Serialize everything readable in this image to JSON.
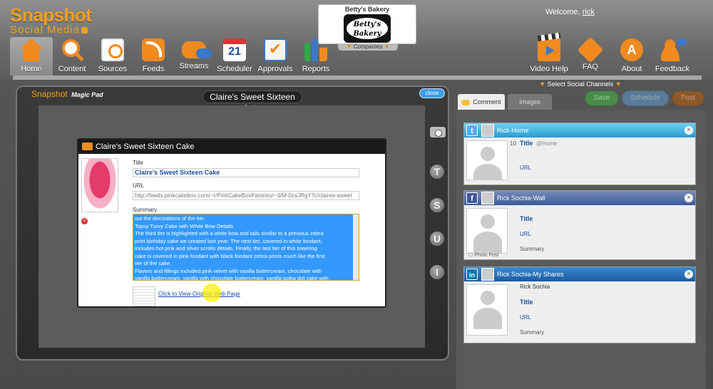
{
  "brand": {
    "line1": "Snapshot",
    "line2": "Social Media"
  },
  "company": {
    "name": "Betty's Bakery",
    "badge_line1": "Betty's",
    "badge_line2": "Bakery",
    "dropdown_label": "Companies"
  },
  "user": {
    "welcome": "Welcome,",
    "name": "rick"
  },
  "nav": {
    "home": "Home",
    "content": "Content",
    "sources": "Sources",
    "feeds": "Feeds",
    "streams": "Streams",
    "scheduler": "Scheduler",
    "scheduler_day": "21",
    "approvals": "Approvals",
    "reports": "Reports",
    "video": "Video Help",
    "faq": "FAQ",
    "about": "About",
    "feedback": "Feedback"
  },
  "pad": {
    "title": "Snapshot",
    "subtitle": "Magic Pad",
    "heading": "Claire's Sweet Sixteen Cake",
    "close": "close",
    "tools": [
      "T",
      "S",
      "U",
      "I"
    ]
  },
  "card": {
    "header": "Claire's Sweet Sixteen Cake",
    "title_label": "Title",
    "title_value": "Claire's Sweet Sixteen Cake",
    "url_label": "URL",
    "url_value": "http://feeds.pinkcakebox.com/~r/PinkCakeBoxPastries/~3/M-0zaJRgYTc/claires-sweet",
    "summary_label": "Summary",
    "summary_lines": [
      "out the decorations of the tier.",
      "Topsy Turvy Cake with White Bow Details",
      "The third tier is highlighted with a white bow and tails similar to a previous zebra",
      "print birthday cake we created last year.  The next tier, covered in white fondant,",
      "includes hot pink and silver scrolls details.  Finally, the last tier of this towering",
      "cake is covered in pink fondant with black fondant zebra prints much like the first",
      "tier of the cake.",
      "Flavors and fillings included pink velvet with vanilla buttercream, chocolate with",
      "vanilla buttercream, vanilla with chocolate buttercream, vanilla polka dot cake with"
    ],
    "original_link": "Click to View Original Web Page"
  },
  "right": {
    "select_channels": "Select Social Channels",
    "tab_comment": "Comment",
    "tab_images": "Images",
    "save": "Save",
    "schedule": "Schedule",
    "post": "Post"
  },
  "channels": [
    {
      "network": "twitter",
      "icon_char": "t",
      "name": "Rick-Home",
      "count": "10",
      "title": "Title",
      "handle": "@Home",
      "url": "URL"
    },
    {
      "network": "facebook",
      "icon_char": "f",
      "name": "Rick Sochia-Wall",
      "title": "Title",
      "url": "URL",
      "summary": "Summary",
      "photo_post": "Photo Post"
    },
    {
      "network": "linkedin",
      "icon_char": "in",
      "name": "Rick Sochia-My Shares",
      "author": "Rick Sochia",
      "title": "Title",
      "url": "URL",
      "summary": "Summary"
    }
  ]
}
